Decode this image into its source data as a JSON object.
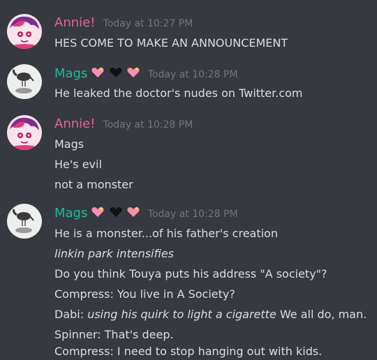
{
  "users": {
    "annie": {
      "name": "Annie!",
      "color": "#e0669a"
    },
    "mags": {
      "name": "Mags",
      "color": "#1abc9c",
      "emojis": [
        "sparkling-heart-icon",
        "black-heart-icon",
        "sparkling-heart-icon"
      ]
    }
  },
  "messages": [
    {
      "author": "Annie!",
      "timestamp": "Today at 10:27 PM",
      "lines": [
        "HES COME TO MAKE AN ANNOUNCEMENT"
      ]
    },
    {
      "author": "Mags",
      "timestamp": "Today at 10:28 PM",
      "lines": [
        "He leaked the doctor's nudes on Twitter.com"
      ]
    },
    {
      "author": "Annie!",
      "timestamp": "Today at 10:28 PM",
      "lines": [
        "Mags",
        "He's evil",
        "not a monster"
      ]
    },
    {
      "author": "Mags",
      "timestamp": "Today at 10:28 PM",
      "lines": [
        "He is a monster...of his father's creation",
        "linkin park intensifies",
        "Do you think Touya puts his address \"A society\"?",
        "Compress: You live in A Society?",
        {
          "prefix": "Dabi: ",
          "italic": "using his quirk to light a cigarette",
          "suffix": " We all do, man."
        },
        "Spinner: That's deep.",
        "Compress: I need to stop hanging out with kids."
      ]
    }
  ]
}
